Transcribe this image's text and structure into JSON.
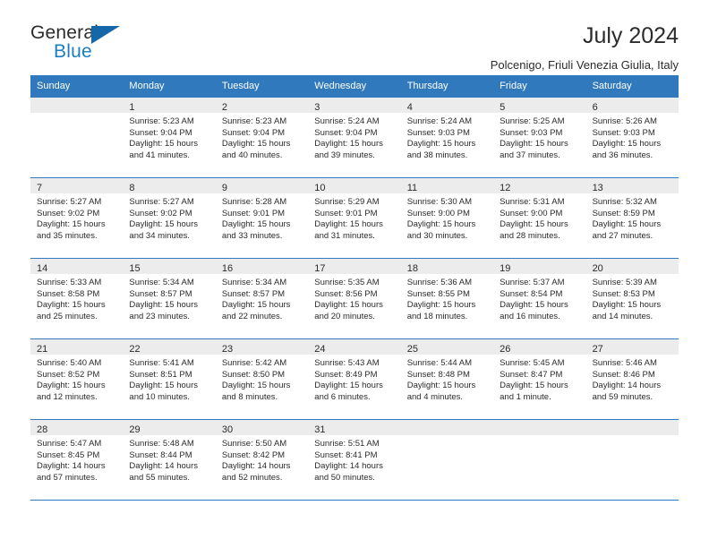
{
  "brand": {
    "name_part1": "General",
    "name_part2": "Blue",
    "accent_color": "#1a7fc1",
    "triangle_color": "#1567a8"
  },
  "header": {
    "title": "July 2024",
    "subtitle": "Polcenigo, Friuli Venezia Giulia, Italy",
    "header_bg_color": "#3079bd",
    "daynum_bg_color": "#ececec"
  },
  "weekdays": [
    "Sunday",
    "Monday",
    "Tuesday",
    "Wednesday",
    "Thursday",
    "Friday",
    "Saturday"
  ],
  "weeks": [
    [
      {
        "day": "",
        "sunrise": "",
        "sunset": "",
        "daylight": ""
      },
      {
        "day": "1",
        "sunrise": "Sunrise: 5:23 AM",
        "sunset": "Sunset: 9:04 PM",
        "daylight": "Daylight: 15 hours and 41 minutes."
      },
      {
        "day": "2",
        "sunrise": "Sunrise: 5:23 AM",
        "sunset": "Sunset: 9:04 PM",
        "daylight": "Daylight: 15 hours and 40 minutes."
      },
      {
        "day": "3",
        "sunrise": "Sunrise: 5:24 AM",
        "sunset": "Sunset: 9:04 PM",
        "daylight": "Daylight: 15 hours and 39 minutes."
      },
      {
        "day": "4",
        "sunrise": "Sunrise: 5:24 AM",
        "sunset": "Sunset: 9:03 PM",
        "daylight": "Daylight: 15 hours and 38 minutes."
      },
      {
        "day": "5",
        "sunrise": "Sunrise: 5:25 AM",
        "sunset": "Sunset: 9:03 PM",
        "daylight": "Daylight: 15 hours and 37 minutes."
      },
      {
        "day": "6",
        "sunrise": "Sunrise: 5:26 AM",
        "sunset": "Sunset: 9:03 PM",
        "daylight": "Daylight: 15 hours and 36 minutes."
      }
    ],
    [
      {
        "day": "7",
        "sunrise": "Sunrise: 5:27 AM",
        "sunset": "Sunset: 9:02 PM",
        "daylight": "Daylight: 15 hours and 35 minutes."
      },
      {
        "day": "8",
        "sunrise": "Sunrise: 5:27 AM",
        "sunset": "Sunset: 9:02 PM",
        "daylight": "Daylight: 15 hours and 34 minutes."
      },
      {
        "day": "9",
        "sunrise": "Sunrise: 5:28 AM",
        "sunset": "Sunset: 9:01 PM",
        "daylight": "Daylight: 15 hours and 33 minutes."
      },
      {
        "day": "10",
        "sunrise": "Sunrise: 5:29 AM",
        "sunset": "Sunset: 9:01 PM",
        "daylight": "Daylight: 15 hours and 31 minutes."
      },
      {
        "day": "11",
        "sunrise": "Sunrise: 5:30 AM",
        "sunset": "Sunset: 9:00 PM",
        "daylight": "Daylight: 15 hours and 30 minutes."
      },
      {
        "day": "12",
        "sunrise": "Sunrise: 5:31 AM",
        "sunset": "Sunset: 9:00 PM",
        "daylight": "Daylight: 15 hours and 28 minutes."
      },
      {
        "day": "13",
        "sunrise": "Sunrise: 5:32 AM",
        "sunset": "Sunset: 8:59 PM",
        "daylight": "Daylight: 15 hours and 27 minutes."
      }
    ],
    [
      {
        "day": "14",
        "sunrise": "Sunrise: 5:33 AM",
        "sunset": "Sunset: 8:58 PM",
        "daylight": "Daylight: 15 hours and 25 minutes."
      },
      {
        "day": "15",
        "sunrise": "Sunrise: 5:34 AM",
        "sunset": "Sunset: 8:57 PM",
        "daylight": "Daylight: 15 hours and 23 minutes."
      },
      {
        "day": "16",
        "sunrise": "Sunrise: 5:34 AM",
        "sunset": "Sunset: 8:57 PM",
        "daylight": "Daylight: 15 hours and 22 minutes."
      },
      {
        "day": "17",
        "sunrise": "Sunrise: 5:35 AM",
        "sunset": "Sunset: 8:56 PM",
        "daylight": "Daylight: 15 hours and 20 minutes."
      },
      {
        "day": "18",
        "sunrise": "Sunrise: 5:36 AM",
        "sunset": "Sunset: 8:55 PM",
        "daylight": "Daylight: 15 hours and 18 minutes."
      },
      {
        "day": "19",
        "sunrise": "Sunrise: 5:37 AM",
        "sunset": "Sunset: 8:54 PM",
        "daylight": "Daylight: 15 hours and 16 minutes."
      },
      {
        "day": "20",
        "sunrise": "Sunrise: 5:39 AM",
        "sunset": "Sunset: 8:53 PM",
        "daylight": "Daylight: 15 hours and 14 minutes."
      }
    ],
    [
      {
        "day": "21",
        "sunrise": "Sunrise: 5:40 AM",
        "sunset": "Sunset: 8:52 PM",
        "daylight": "Daylight: 15 hours and 12 minutes."
      },
      {
        "day": "22",
        "sunrise": "Sunrise: 5:41 AM",
        "sunset": "Sunset: 8:51 PM",
        "daylight": "Daylight: 15 hours and 10 minutes."
      },
      {
        "day": "23",
        "sunrise": "Sunrise: 5:42 AM",
        "sunset": "Sunset: 8:50 PM",
        "daylight": "Daylight: 15 hours and 8 minutes."
      },
      {
        "day": "24",
        "sunrise": "Sunrise: 5:43 AM",
        "sunset": "Sunset: 8:49 PM",
        "daylight": "Daylight: 15 hours and 6 minutes."
      },
      {
        "day": "25",
        "sunrise": "Sunrise: 5:44 AM",
        "sunset": "Sunset: 8:48 PM",
        "daylight": "Daylight: 15 hours and 4 minutes."
      },
      {
        "day": "26",
        "sunrise": "Sunrise: 5:45 AM",
        "sunset": "Sunset: 8:47 PM",
        "daylight": "Daylight: 15 hours and 1 minute."
      },
      {
        "day": "27",
        "sunrise": "Sunrise: 5:46 AM",
        "sunset": "Sunset: 8:46 PM",
        "daylight": "Daylight: 14 hours and 59 minutes."
      }
    ],
    [
      {
        "day": "28",
        "sunrise": "Sunrise: 5:47 AM",
        "sunset": "Sunset: 8:45 PM",
        "daylight": "Daylight: 14 hours and 57 minutes."
      },
      {
        "day": "29",
        "sunrise": "Sunrise: 5:48 AM",
        "sunset": "Sunset: 8:44 PM",
        "daylight": "Daylight: 14 hours and 55 minutes."
      },
      {
        "day": "30",
        "sunrise": "Sunrise: 5:50 AM",
        "sunset": "Sunset: 8:42 PM",
        "daylight": "Daylight: 14 hours and 52 minutes."
      },
      {
        "day": "31",
        "sunrise": "Sunrise: 5:51 AM",
        "sunset": "Sunset: 8:41 PM",
        "daylight": "Daylight: 14 hours and 50 minutes."
      },
      {
        "day": "",
        "sunrise": "",
        "sunset": "",
        "daylight": ""
      },
      {
        "day": "",
        "sunrise": "",
        "sunset": "",
        "daylight": ""
      },
      {
        "day": "",
        "sunrise": "",
        "sunset": "",
        "daylight": ""
      }
    ]
  ]
}
